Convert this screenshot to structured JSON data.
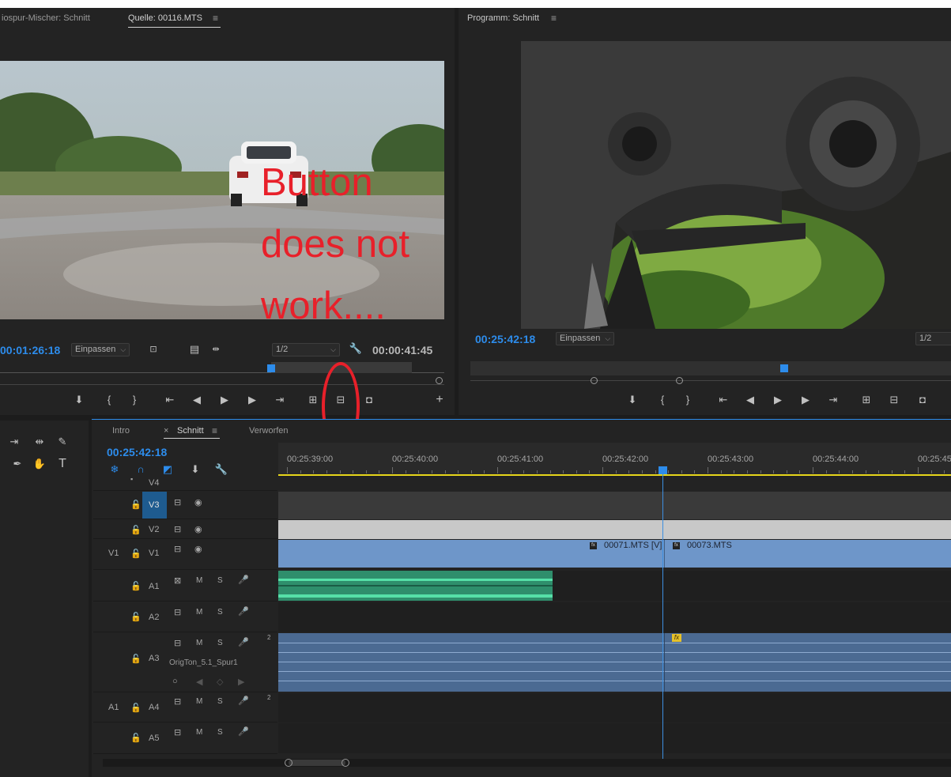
{
  "source_monitor": {
    "tab_mixer": "iospur-Mischer: Schnitt",
    "tab_source": "Quelle: 00116.MTS",
    "timecode_in": "00:01:26:18",
    "fit_label": "Einpassen",
    "resolution": "1/2",
    "timecode_duration": "00:00:41:45",
    "annotation": "Button does not work...."
  },
  "program_monitor": {
    "tab_title": "Programm: Schnitt",
    "timecode": "00:25:42:18",
    "fit_label": "Einpassen",
    "resolution": "1/2"
  },
  "timeline": {
    "tabs": [
      "Intro",
      "Schnitt",
      "Verworfen"
    ],
    "active_tab": "Schnitt",
    "timecode": "00:25:42:18",
    "ruler_labels": [
      "00:25:39:00",
      "00:25:40:00",
      "00:25:41:00",
      "00:25:42:00",
      "00:25:43:00",
      "00:25:44:00",
      "00:25:45"
    ],
    "tracks": {
      "v4": "V4",
      "v3": "V3",
      "v2": "V2",
      "v1": "V1",
      "v1_src": "V1",
      "a1": "A1",
      "a2": "A2",
      "a3": "A3",
      "a4": "A4",
      "a4_src": "A1",
      "a5": "A5"
    },
    "mute": "M",
    "solo": "S",
    "a3_name": "OrigTon_5.1_Spur1",
    "channel_count": "2",
    "clip_1": "00071.MTS [V]",
    "clip_2": "00073.MTS",
    "fx_badge": "fx"
  },
  "colors": {
    "accent_blue": "#2d8ceb",
    "annotation_red": "#e8202a",
    "video_clip": "#6e96c9",
    "audio_clip_green": "#2f8e6c",
    "audio_clip_blue": "#4b6a92"
  }
}
